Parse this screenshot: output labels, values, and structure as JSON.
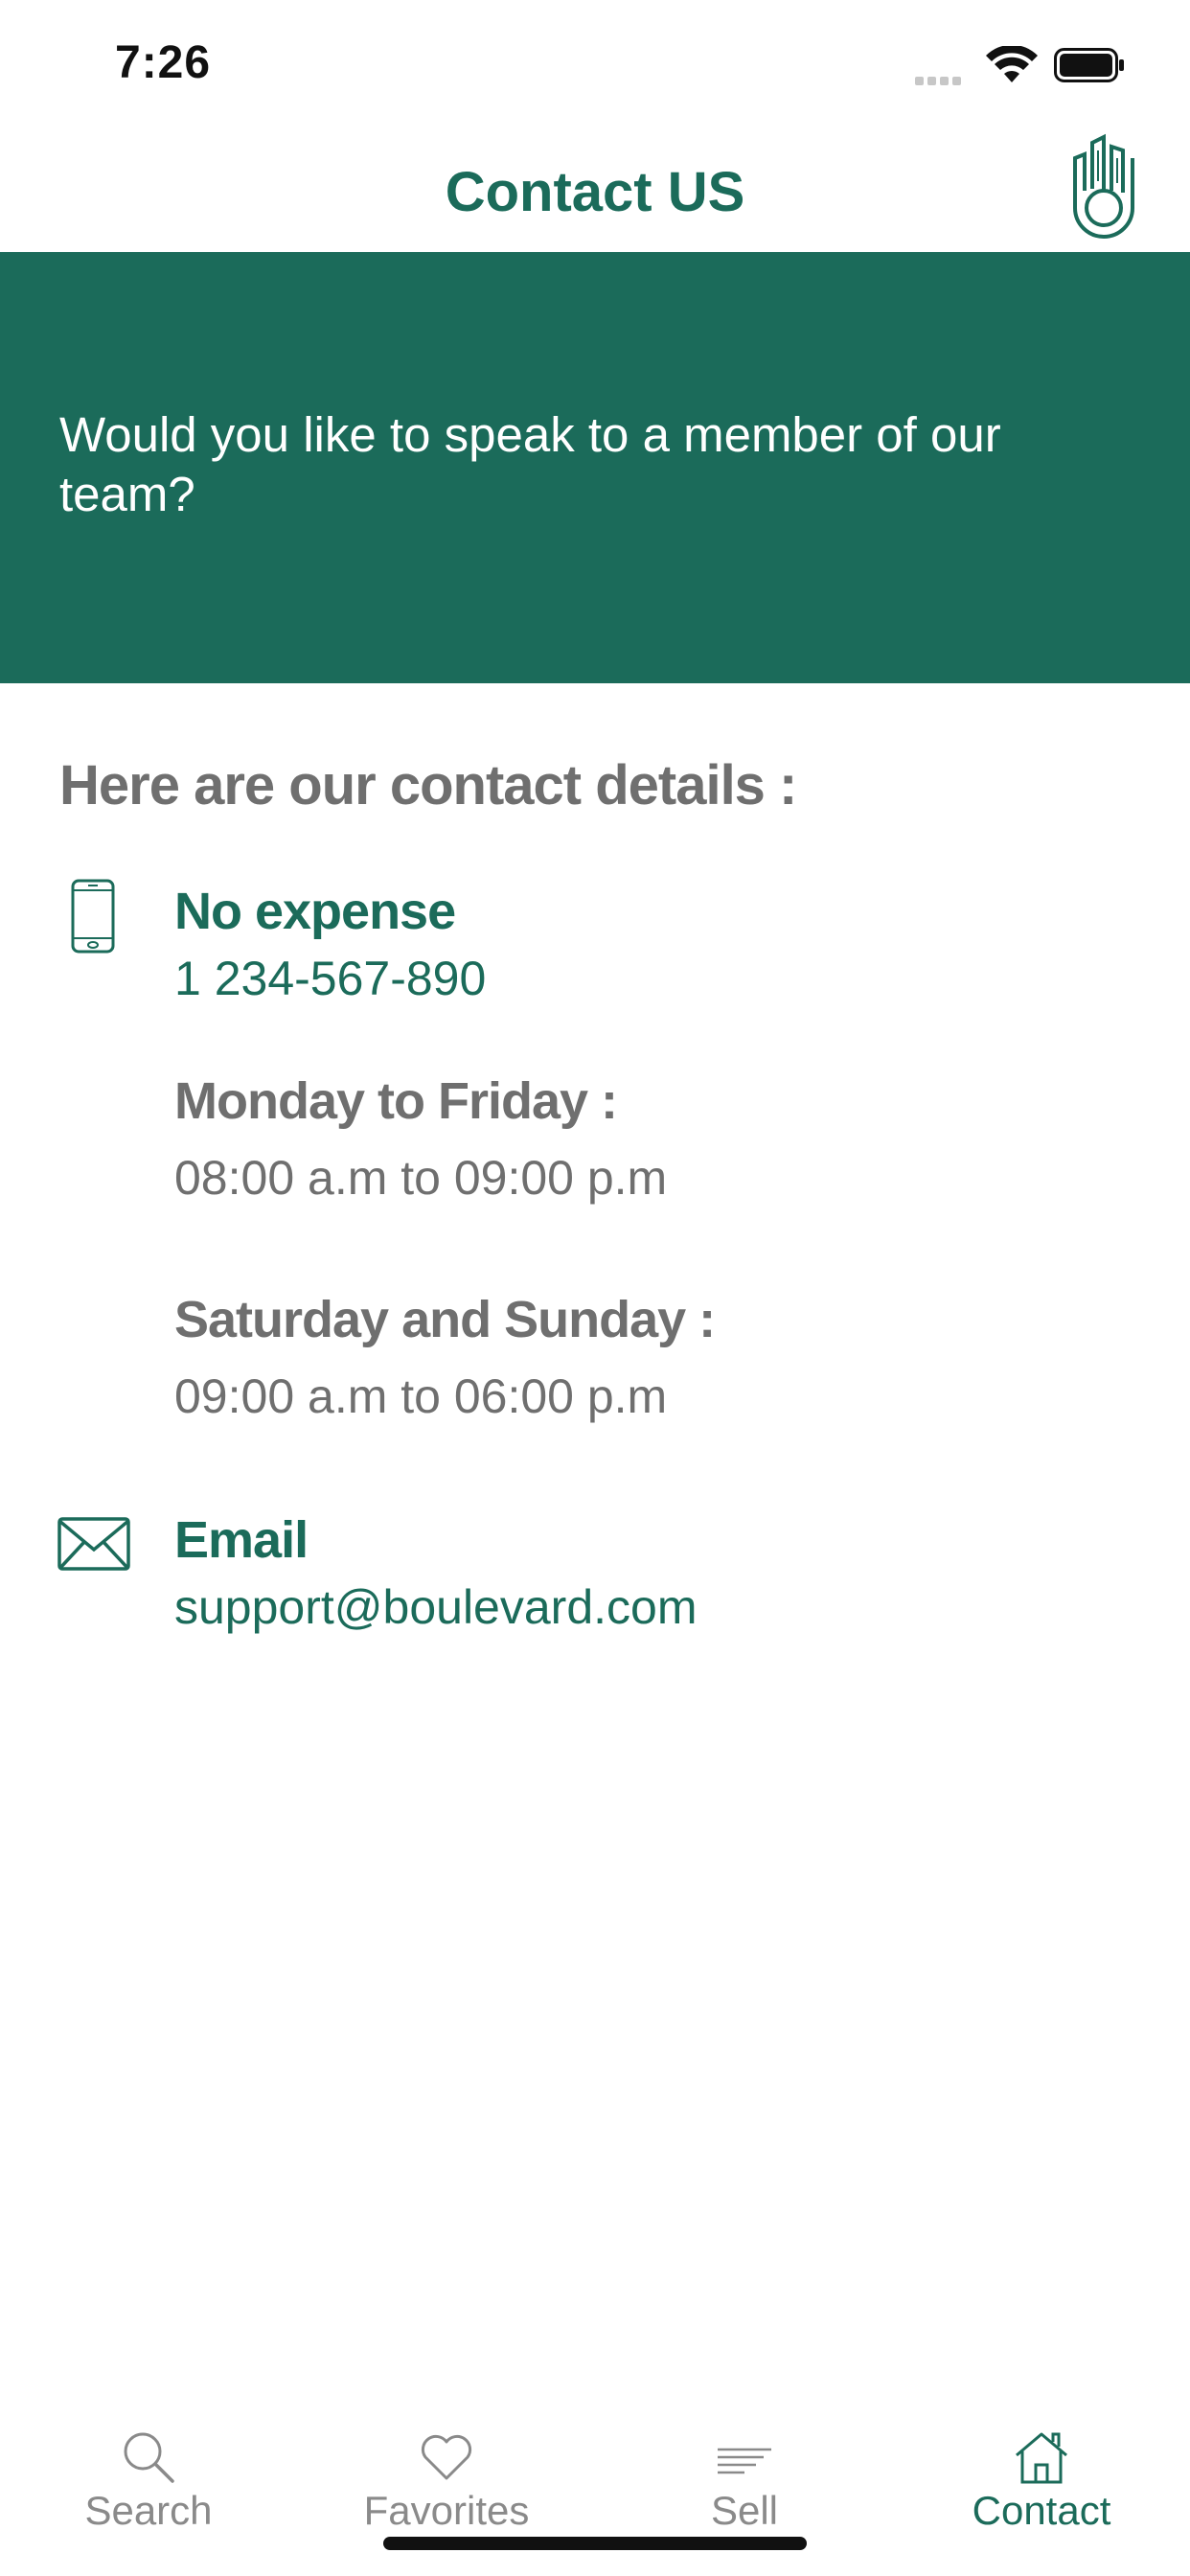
{
  "status_bar": {
    "time": "7:26"
  },
  "header": {
    "title": "Contact US"
  },
  "banner": {
    "text": "Would you like to speak to a member of our team?"
  },
  "contact": {
    "heading": "Here are our contact details :",
    "phone": {
      "title": "No expense",
      "number": "1 234-567-890"
    },
    "weekday": {
      "title": "Monday to Friday :",
      "hours": "08:00 a.m to 09:00 p.m"
    },
    "weekend": {
      "title": "Saturday and Sunday :",
      "hours": "09:00 a.m to 06:00 p.m"
    },
    "email": {
      "title": "Email",
      "address": "support@boulevard.com"
    }
  },
  "tab_bar": {
    "items": [
      {
        "label": "Search",
        "icon": "search-icon",
        "active": false
      },
      {
        "label": "Favorites",
        "icon": "heart-icon",
        "active": false
      },
      {
        "label": "Sell",
        "icon": "sell-icon",
        "active": false
      },
      {
        "label": "Contact",
        "icon": "home-icon",
        "active": true
      }
    ]
  },
  "colors": {
    "brand": "#1b6b5a",
    "text_gray": "#6f6f6f",
    "tab_inactive": "#8a8a8a"
  }
}
